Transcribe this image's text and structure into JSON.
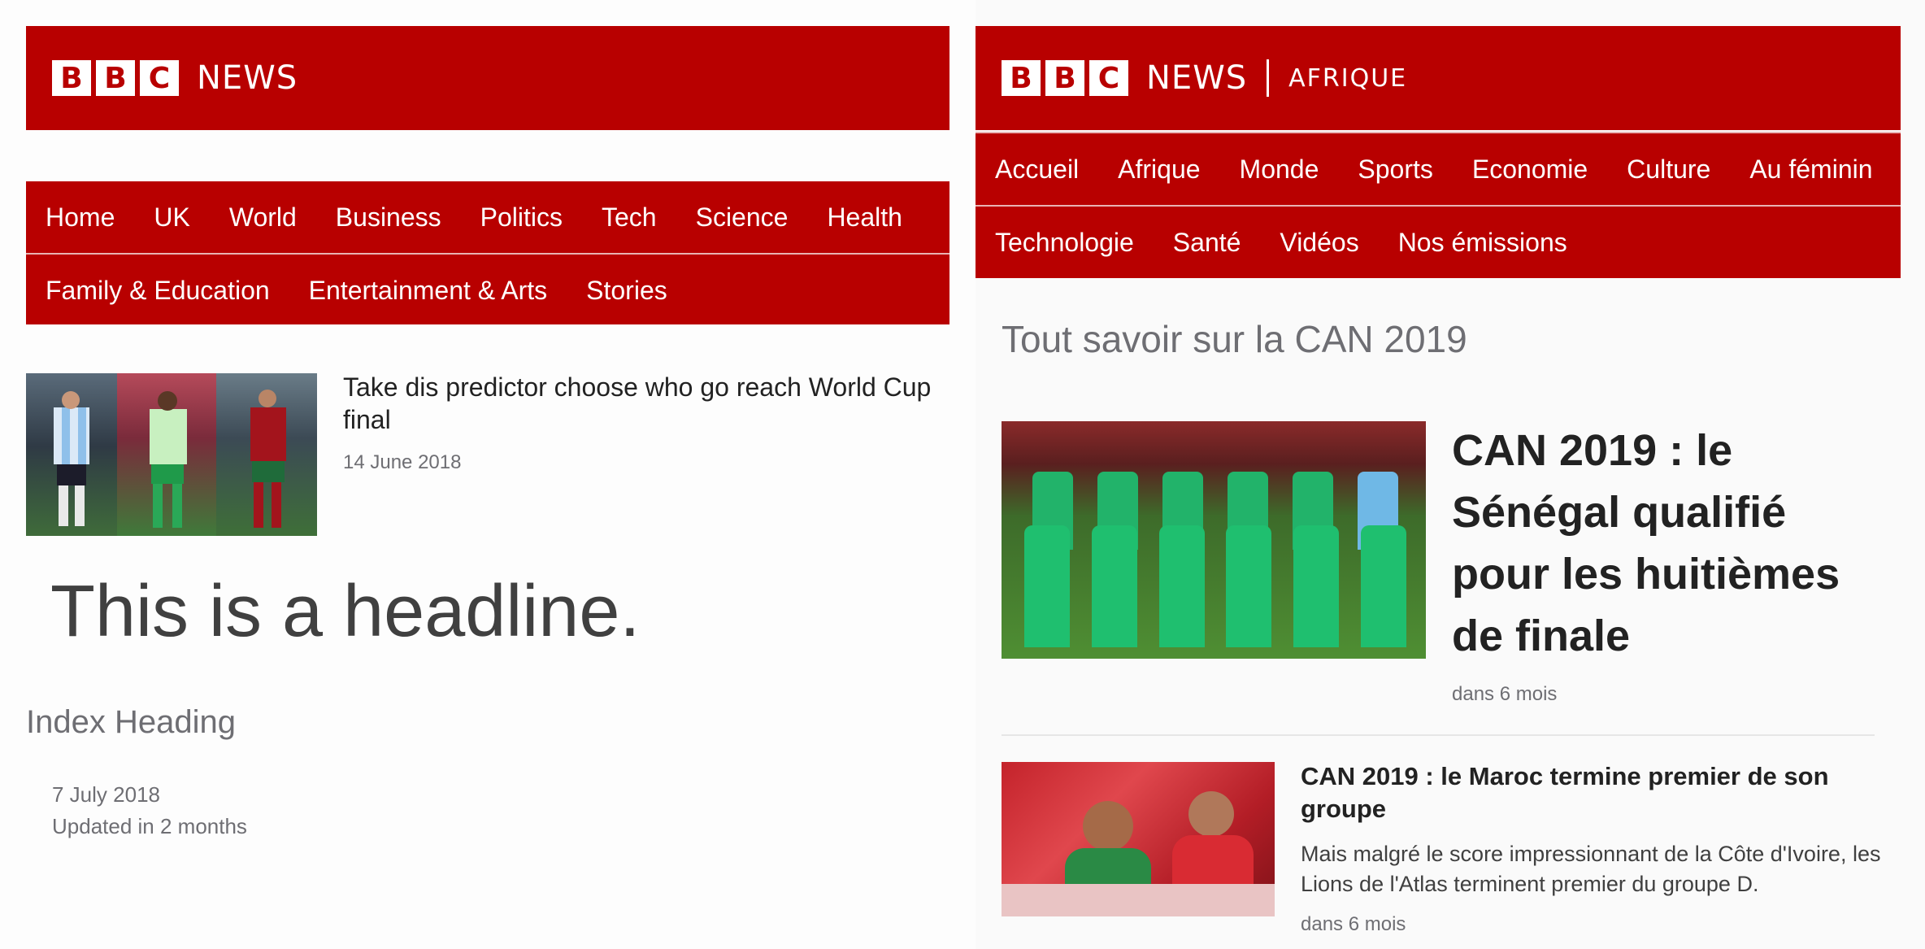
{
  "left": {
    "brand": {
      "letters": [
        "B",
        "B",
        "C"
      ],
      "wordmark": "NEWS"
    },
    "nav": {
      "row1": [
        "Home",
        "UK",
        "World",
        "Business",
        "Politics",
        "Tech",
        "Science",
        "Health"
      ],
      "row2": [
        "Family & Education",
        "Entertainment & Arts",
        "Stories"
      ]
    },
    "promo": {
      "headline": "Take dis predictor choose who go reach World Cup final",
      "date": "14 June 2018"
    },
    "big_headline": "This is a headline.",
    "index_heading": "Index Heading",
    "timestamp": "7 July 2018",
    "updated": "Updated in 2 months"
  },
  "right": {
    "brand": {
      "letters": [
        "B",
        "B",
        "C"
      ],
      "wordmark": "NEWS",
      "service": "AFRIQUE"
    },
    "nav": {
      "row1": [
        "Accueil",
        "Afrique",
        "Monde",
        "Sports",
        "Economie",
        "Culture",
        "Au féminin"
      ],
      "row2": [
        "Technologie",
        "Santé",
        "Vidéos",
        "Nos émissions"
      ]
    },
    "section_heading": "Tout savoir sur la CAN 2019",
    "top_story": {
      "headline": "CAN 2019 : le Sénégal qualifié pour les huitièmes de finale",
      "time": "dans 6 mois"
    },
    "story2": {
      "headline": "CAN 2019 : le Maroc termine premier de son groupe",
      "summary": "Mais malgré le score impressionnant de la Côte d'Ivoire, les Lions de l'Atlas terminent premier du groupe D.",
      "time": "dans 6 mois"
    }
  },
  "colors": {
    "brand_red": "#b80000",
    "text_dark": "#222222",
    "text_muted": "#6e6e73"
  }
}
